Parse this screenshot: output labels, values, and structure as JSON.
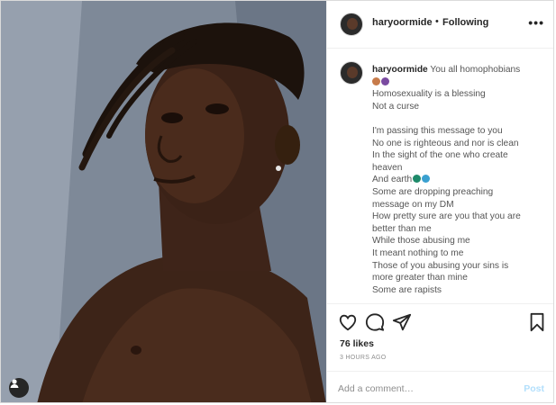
{
  "post": {
    "username": "haryoormide",
    "separator": "•",
    "follow_status": "Following",
    "more_icon": "ellipsis-icon"
  },
  "caption": {
    "username": "haryoormide",
    "first_line": "You all homophobians",
    "lines": [
      "Homosexuality is a blessing",
      "Not a curse",
      "",
      "I'm passing this message to you",
      "No one is righteous and nor is clean",
      "In the sight of the one who create",
      "heaven",
      "And earth",
      "Some are dropping preaching",
      "message on my DM",
      "How pretty sure are you that you are",
      "better than me",
      "While those abusing me",
      "It meant nothing to me",
      "Those of you abusing your sins is",
      "more greater than mine",
      "Some are rapists"
    ],
    "emoji_colors": [
      "#c77b4a",
      "#7a4aa0",
      "#1e8a6a",
      "#3aa0d0"
    ]
  },
  "engagement": {
    "likes": "76 likes",
    "time": "3 HOURS AGO"
  },
  "comment": {
    "placeholder": "Add a comment…",
    "post_label": "Post"
  },
  "colors": {
    "link_disabled": "#b2dffc",
    "border": "#efefef"
  }
}
